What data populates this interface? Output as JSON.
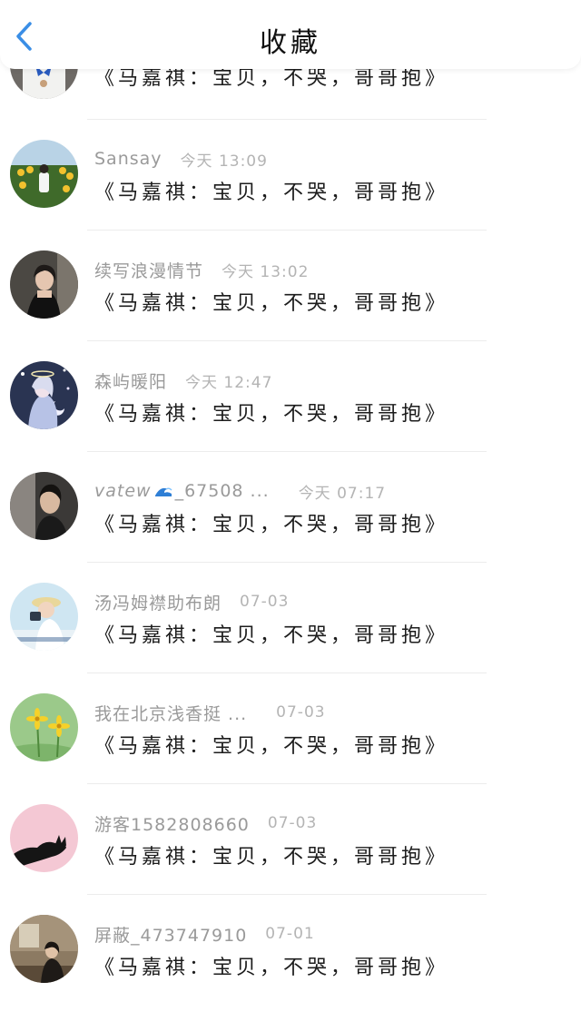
{
  "header": {
    "title": "收藏",
    "back_icon": "chevron-left-icon",
    "accent_color": "#3a8ee6"
  },
  "items": [
    {
      "name": "",
      "time": "",
      "message": "《马嘉祺：宝贝，不哭，哥哥抱》",
      "avatar": "avatar-butterfly-shirt"
    },
    {
      "name": "Sansay",
      "time": "今天 13:09",
      "message": "《马嘉祺：宝贝，不哭，哥哥抱》",
      "avatar": "avatar-sunflower-field"
    },
    {
      "name": "续写浪漫情节",
      "time": "今天 13:02",
      "message": "《马嘉祺：宝贝，不哭，哥哥抱》",
      "avatar": "avatar-girl-dark"
    },
    {
      "name": "森屿暖阳",
      "time": "今天 12:47",
      "message": "《马嘉祺：宝贝，不哭，哥哥抱》",
      "avatar": "avatar-anime-girl"
    },
    {
      "name": "vatew",
      "name_suffix": "_67508 ...",
      "time": "今天 07:17",
      "message": "《马嘉祺：宝贝，不哭，哥哥抱》",
      "avatar": "avatar-boy-portrait",
      "name_icon": "wave-icon"
    },
    {
      "name": "汤冯姆襟助布朗",
      "time": "07-03",
      "message": "《马嘉祺：宝贝，不哭，哥哥抱》",
      "avatar": "avatar-camera-girl"
    },
    {
      "name": "我在北京浅香挺 ...",
      "time": "07-03",
      "message": "《马嘉祺：宝贝，不哭，哥哥抱》",
      "avatar": "avatar-yellow-flowers"
    },
    {
      "name": "游客1582808660",
      "time": "07-03",
      "message": "《马嘉祺：宝贝，不哭，哥哥抱》",
      "avatar": "avatar-black-cat"
    },
    {
      "name": "屏蔽_473747910",
      "time": "07-01",
      "message": "《马嘉祺：宝贝，不哭，哥哥抱》",
      "avatar": "avatar-room-girl"
    }
  ]
}
